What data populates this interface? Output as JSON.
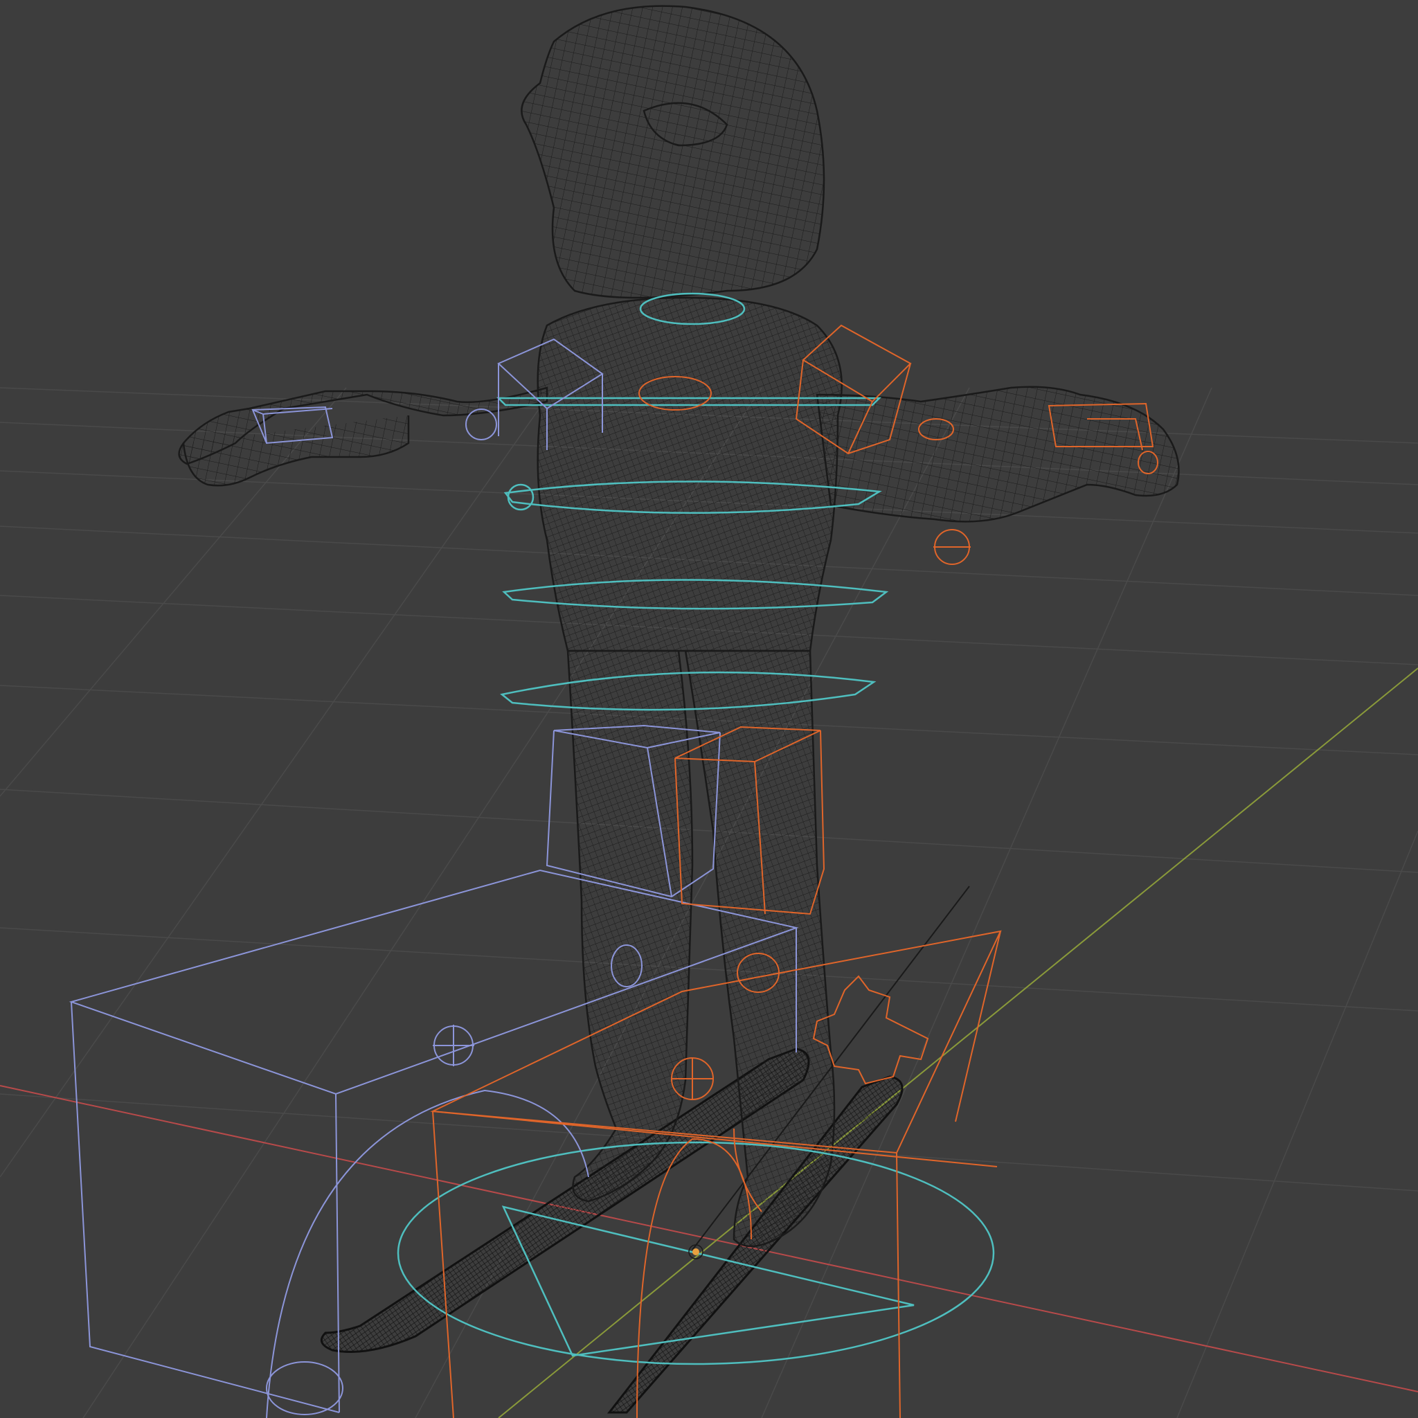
{
  "viewport": {
    "mode": "wireframe",
    "background_color": "#3d3d3d",
    "grid_color": "#4a4a4a",
    "axis_x_color": "#b84a4a",
    "axis_y_color": "#8a9a3a",
    "mesh_wire_color": "#1a1a1a",
    "left_controls_color": "#8c95d9",
    "right_controls_color": "#e0652a",
    "center_controls_color": "#4fbfbf",
    "origin_marker_color": "#e8a040"
  },
  "scene": {
    "objects": [
      {
        "name": "character-mesh",
        "kind": "mesh"
      },
      {
        "name": "ski-left",
        "kind": "mesh"
      },
      {
        "name": "ski-right",
        "kind": "mesh"
      },
      {
        "name": "rig-controls",
        "kind": "armature"
      }
    ]
  }
}
